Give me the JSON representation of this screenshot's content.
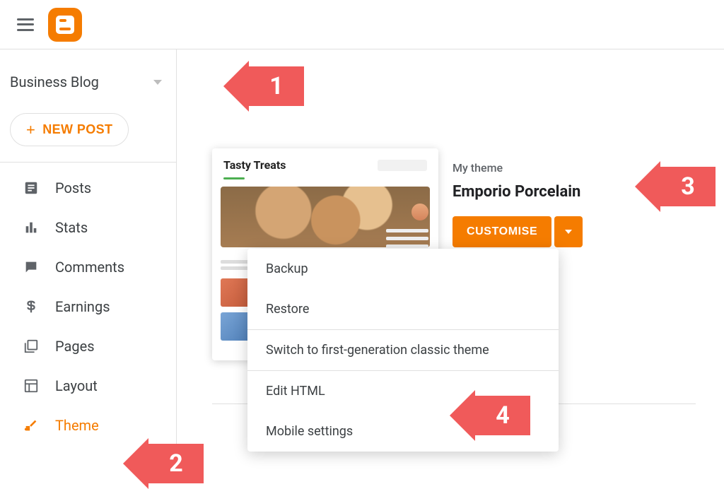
{
  "header": {
    "blog_name": "Business Blog"
  },
  "new_post_label": "NEW POST",
  "sidebar": {
    "items": [
      {
        "label": "Posts"
      },
      {
        "label": "Stats"
      },
      {
        "label": "Comments"
      },
      {
        "label": "Earnings"
      },
      {
        "label": "Pages"
      },
      {
        "label": "Layout"
      },
      {
        "label": "Theme"
      }
    ]
  },
  "theme": {
    "my_theme_label": "My theme",
    "name": "Emporio Porcelain",
    "customise_label": "CUSTOMISE",
    "preview_title": "Tasty Treats"
  },
  "dropdown_menu": {
    "items": [
      "Backup",
      "Restore",
      "Switch to first-generation classic theme",
      "Edit HTML",
      "Mobile settings"
    ]
  },
  "callouts": {
    "c1": "1",
    "c2": "2",
    "c3": "3",
    "c4": "4"
  }
}
